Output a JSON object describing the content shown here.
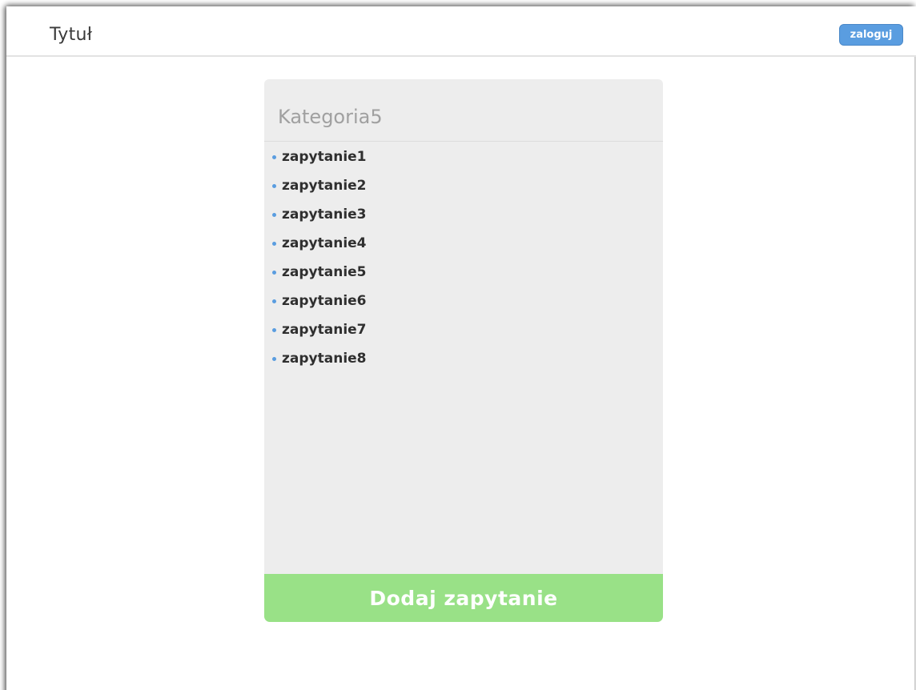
{
  "header": {
    "title": "Tytuł",
    "login_label": "zaloguj"
  },
  "category": {
    "name": "Kategoria5",
    "queries": [
      {
        "label": "zapytanie1"
      },
      {
        "label": "zapytanie2"
      },
      {
        "label": "zapytanie3"
      },
      {
        "label": "zapytanie4"
      },
      {
        "label": "zapytanie5"
      },
      {
        "label": "zapytanie6"
      },
      {
        "label": "zapytanie7"
      },
      {
        "label": "zapytanie8"
      }
    ]
  },
  "actions": {
    "add_query_label": "Dodaj zapytanie"
  },
  "colors": {
    "accent_blue": "#5a9de0",
    "add_button_green": "#99e187",
    "panel_bg": "#ededed"
  }
}
